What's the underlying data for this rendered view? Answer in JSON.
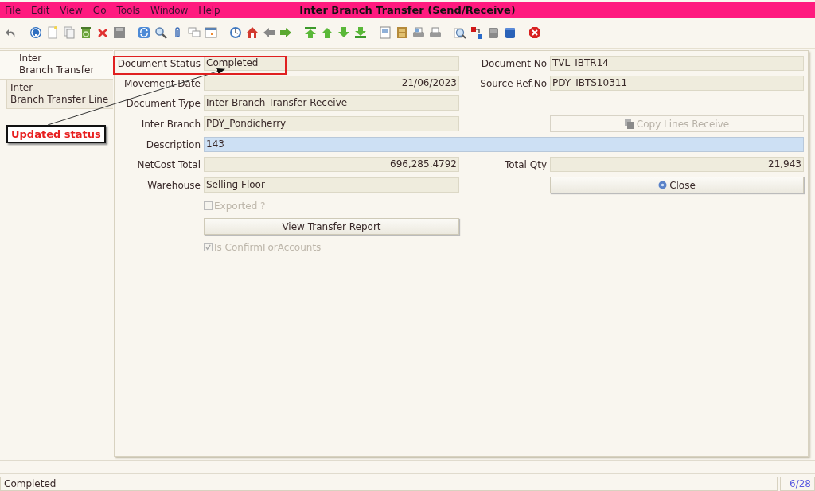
{
  "window": {
    "title": "Inter Branch Transfer (Send/Receive)"
  },
  "menu": [
    {
      "label": "File"
    },
    {
      "label": "Edit"
    },
    {
      "label": "View"
    },
    {
      "label": "Go"
    },
    {
      "label": "Tools"
    },
    {
      "label": "Window"
    },
    {
      "label": "Help"
    }
  ],
  "tabs": [
    {
      "label": "Inter\nBranch Transfer",
      "selected": true
    },
    {
      "label": "Inter\nBranch Transfer Line",
      "selected": false
    }
  ],
  "annotation": {
    "text": "Updated status"
  },
  "rows": [
    {
      "left": {
        "kind": "field",
        "label": "Document Status",
        "value": "Completed",
        "annotated": true
      },
      "right": {
        "kind": "field",
        "label": "Document No",
        "value": "TVL_IBTR14"
      }
    },
    {
      "left": {
        "kind": "field",
        "label": "Movement Date",
        "value": "21/06/2023",
        "numeric": true
      },
      "right": {
        "kind": "field",
        "label": "Source Ref.No",
        "value": "PDY_IBTS10311"
      }
    },
    {
      "left": {
        "kind": "field",
        "label": "Document Type",
        "value": "Inter Branch Transfer Receive"
      }
    },
    {
      "left": {
        "kind": "field",
        "label": "Inter Branch",
        "value": "PDY_Pondicherry"
      },
      "right": {
        "kind": "action",
        "label": "Copy Lines Receive",
        "disabled": true
      }
    },
    {
      "left": {
        "kind": "wide",
        "label": "Description",
        "value": "143",
        "focused": true
      }
    },
    {
      "left": {
        "kind": "field",
        "label": "NetCost Total",
        "value": "696,285.4792",
        "numeric": true
      },
      "right": {
        "kind": "field",
        "label": "Total Qty",
        "value": "21,943",
        "numeric": true
      }
    },
    {
      "left": {
        "kind": "field",
        "label": "Warehouse",
        "value": "Selling Floor"
      },
      "right": {
        "kind": "action",
        "label": "Close",
        "disabled": false
      }
    },
    {
      "left": {
        "kind": "checkbox",
        "label": "Exported ?",
        "checked": false,
        "disabled": true
      }
    },
    {
      "left": {
        "kind": "button",
        "label": "View Transfer Report",
        "disabled": false
      }
    },
    {
      "left": {
        "kind": "checkbox",
        "label": "Is ConfirmForAccounts",
        "checked": true,
        "disabled": true
      }
    }
  ],
  "status_bar": {
    "message": "Completed",
    "record": "6/28"
  }
}
